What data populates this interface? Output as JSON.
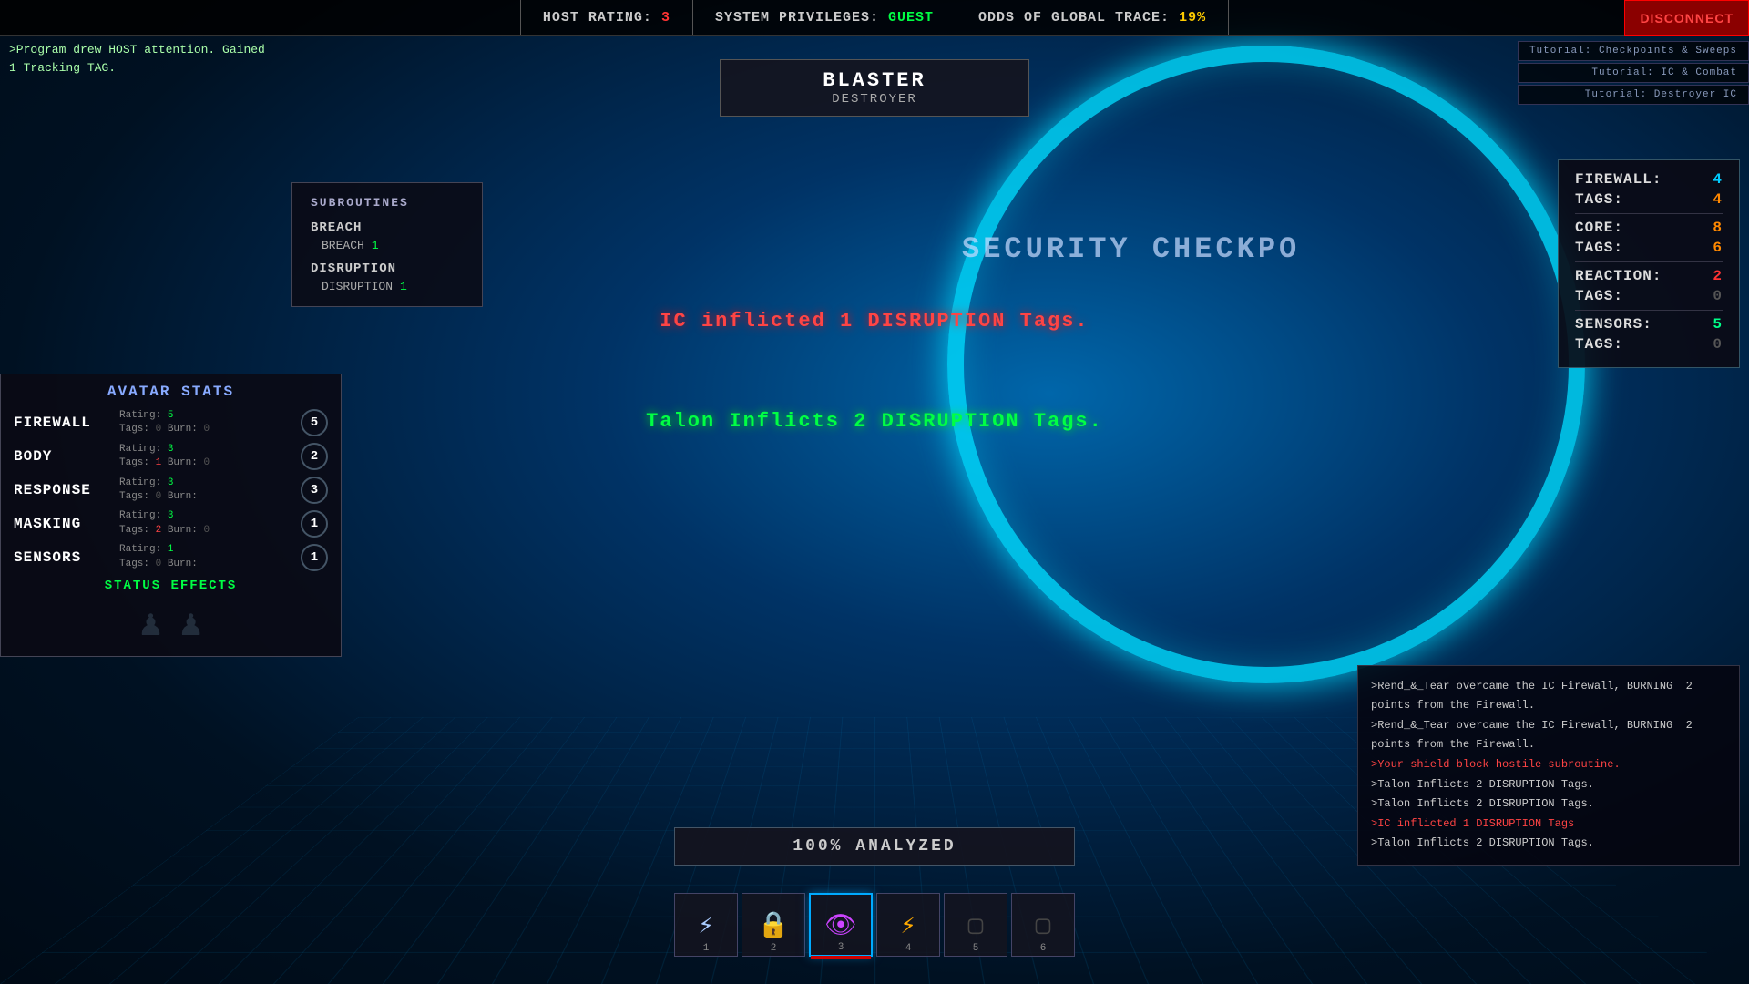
{
  "header": {
    "host_rating_label": "HOST Rating:",
    "host_rating_value": "3",
    "privileges_label": "System Privileges:",
    "privileges_value": "GUEST",
    "trace_label": "Odds of Global Trace:",
    "trace_value": "19%",
    "disconnect_label": "Disconnect"
  },
  "console": {
    "line1": ">Program drew HOST attention. Gained",
    "line2": "1 Tracking TAG."
  },
  "enemy": {
    "name": "Blaster",
    "type": "Destroyer"
  },
  "tutorials": [
    "Tutorial: Checkpoints & Sweeps",
    "Tutorial: IC & Combat",
    "Tutorial: Destroyer IC"
  ],
  "host_stats": {
    "firewall_label": "Firewall:",
    "firewall_value": "4",
    "firewall_tags_label": "TAGS:",
    "firewall_tags_value": "4",
    "core_label": "Core:",
    "core_value": "8",
    "core_tags_label": "TAGS:",
    "core_tags_value": "6",
    "reaction_label": "Reaction:",
    "reaction_value": "2",
    "reaction_tags_label": "TAGS:",
    "reaction_tags_value": "0",
    "sensors_label": "Sensors:",
    "sensors_value": "5",
    "sensors_tags_label": "TAGS:",
    "sensors_tags_value": "0"
  },
  "subroutines": {
    "title": "Subroutines",
    "categories": [
      {
        "name": "Breach",
        "items": [
          {
            "name": "Breach",
            "count": "1"
          }
        ]
      },
      {
        "name": "Disruption",
        "items": [
          {
            "name": "Disruption",
            "count": "1"
          }
        ]
      }
    ]
  },
  "avatar": {
    "title": "Avatar Stats",
    "stats": [
      {
        "name": "Firewall",
        "rating": "5",
        "tags": "0",
        "burn": "0",
        "circle": "5"
      },
      {
        "name": "Body",
        "rating": "3",
        "tags": "1",
        "burn": "0",
        "circle": "2"
      },
      {
        "name": "Response",
        "rating": "3",
        "tags": "0",
        "burn": "",
        "circle": "3"
      },
      {
        "name": "Masking",
        "rating": "3",
        "tags": "2",
        "burn": "0",
        "circle": "1"
      },
      {
        "name": "Sensors",
        "rating": "1",
        "tags": "0",
        "burn": "",
        "circle": "1"
      }
    ],
    "status_effects_label": "Status Effects"
  },
  "combat_messages": {
    "msg1": "IC inflicted 1 DISRUPTION Tags.",
    "msg2": "Talon Inflicts 2 DISRUPTION Tags."
  },
  "security_text": "SECURITY CHECKPO",
  "analysis": {
    "text": "100% Analyzed"
  },
  "combat_log": [
    {
      "type": "normal",
      "text": ">Rend_&_Tear overcame the IC Firewall, BURNING  2 points from the Firewall."
    },
    {
      "type": "normal",
      "text": ">Rend_&_Tear overcame the IC Firewall, BURNING  2 points from the Firewall."
    },
    {
      "type": "warning",
      "text": ">Your shield block hostile subroutine."
    },
    {
      "type": "normal",
      "text": ">Talon Inflicts 2 DISRUPTION Tags."
    },
    {
      "type": "normal",
      "text": ">Talon Inflicts 2 DISRUPTION Tags."
    },
    {
      "type": "warning",
      "text": ">IC inflicted 1 DISRUPTION Tags"
    },
    {
      "type": "normal",
      "text": ">Talon Inflicts 2 DISRUPTION Tags."
    }
  ],
  "hotbar": {
    "slots": [
      {
        "num": "1",
        "icon": "⚡",
        "active": false,
        "class": "icon-lightning"
      },
      {
        "num": "2",
        "icon": "🔒",
        "active": false,
        "class": "icon-lock"
      },
      {
        "num": "3",
        "icon": "👁",
        "active": true,
        "class": "icon-eye"
      },
      {
        "num": "4",
        "icon": "⚡",
        "active": false,
        "class": "icon-bolt"
      },
      {
        "num": "5",
        "icon": "▢",
        "active": false,
        "class": "icon-blank"
      },
      {
        "num": "6",
        "icon": "▢",
        "active": false,
        "class": "icon-blank"
      }
    ]
  }
}
